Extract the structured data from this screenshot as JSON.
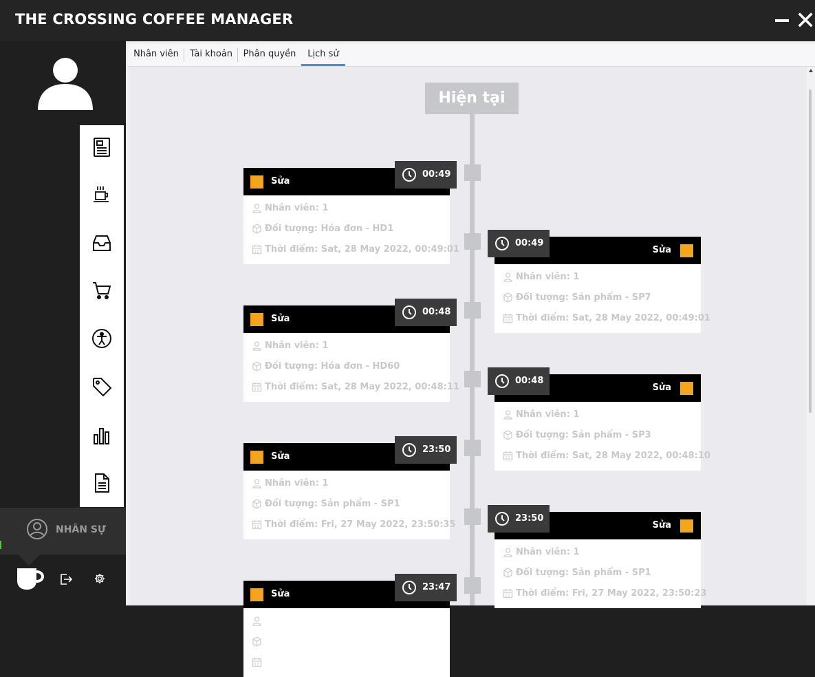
{
  "app": {
    "title": "THE CROSSING COFFEE MANAGER"
  },
  "tabs": [
    {
      "label": "Nhân viên"
    },
    {
      "label": "Tài khoản"
    },
    {
      "label": "Phân quyền"
    },
    {
      "label": "Lịch sử"
    }
  ],
  "sidebar": {
    "active_section": "NHÂN SỰ",
    "nav_icons": [
      "receipt-icon",
      "coffee-cup-icon",
      "inbox-icon",
      "cart-icon",
      "person-icon",
      "tag-icon",
      "bar-chart-icon",
      "document-icon"
    ],
    "bottom_icons": [
      "cup-icon",
      "logout-icon",
      "gear-icon"
    ]
  },
  "timeline": {
    "now_label": "Hiện tại",
    "accent_color": "#f5a41d",
    "entries": [
      {
        "side": "left",
        "action": "Sửa",
        "time": "00:49",
        "employee": "Nhân viên: 1",
        "object": "Đối tượng: Hóa đơn - HD1",
        "when": "Thời điểm: Sat, 28 May 2022, 00:49:01"
      },
      {
        "side": "right",
        "action": "Sửa",
        "time": "00:49",
        "employee": "Nhân viên: 1",
        "object": "Đối tượng: Sản phẩm - SP7",
        "when": "Thời điểm: Sat, 28 May 2022, 00:49:01"
      },
      {
        "side": "left",
        "action": "Sửa",
        "time": "00:48",
        "employee": "Nhân viên: 1",
        "object": "Đối tượng: Hóa đơn - HD60",
        "when": "Thời điểm: Sat, 28 May 2022, 00:48:11"
      },
      {
        "side": "right",
        "action": "Sửa",
        "time": "00:48",
        "employee": "Nhân viên: 1",
        "object": "Đối tượng: Sản phẩm - SP3",
        "when": "Thời điểm: Sat, 28 May 2022, 00:48:10"
      },
      {
        "side": "left",
        "action": "Sửa",
        "time": "23:50",
        "employee": "Nhân viên: 1",
        "object": "Đối tượng: Sản phẩm - SP1",
        "when": "Thời điểm: Fri, 27 May 2022, 23:50:35"
      },
      {
        "side": "right",
        "action": "Sửa",
        "time": "23:50",
        "employee": "Nhân viên: 1",
        "object": "Đối tượng: Sản phẩm - SP1",
        "when": "Thời điểm: Fri, 27 May 2022, 23:50:23"
      },
      {
        "side": "left",
        "action": "Sửa",
        "time": "23:47",
        "employee": "",
        "object": "",
        "when": ""
      }
    ]
  }
}
